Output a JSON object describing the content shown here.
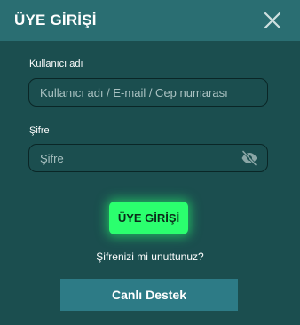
{
  "modal": {
    "title": "ÜYE GİRİŞİ",
    "close_icon": "close-icon"
  },
  "username": {
    "label": "Kullanıcı adı",
    "placeholder": "Kullanıcı adı / E-mail / Cep numarası",
    "value": ""
  },
  "password": {
    "label": "Şifre",
    "placeholder": "Şifre",
    "value": "",
    "toggle_icon": "eye-off-icon"
  },
  "actions": {
    "login_label": "ÜYE GİRİŞİ",
    "forgot_label": "Şifrenizi mi unuttunuz?",
    "support_label": "Canlı Destek"
  },
  "colors": {
    "background": "#1b4e4f",
    "header": "#2a6e72",
    "login_button": "#2bff6e",
    "support_button": "#2d7b86"
  }
}
